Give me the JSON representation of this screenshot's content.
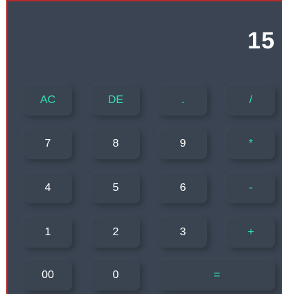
{
  "display": {
    "value": "15"
  },
  "keys": {
    "ac": "AC",
    "de": "DE",
    "dot": ".",
    "divide": "/",
    "seven": "7",
    "eight": "8",
    "nine": "9",
    "multiply": "*",
    "four": "4",
    "five": "5",
    "six": "6",
    "minus": "-",
    "one": "1",
    "two": "2",
    "three": "3",
    "plus": "+",
    "double_zero": "00",
    "zero": "0",
    "equals": "="
  },
  "colors": {
    "background": "#3b4452",
    "key": "#3a4350",
    "accent": "#2fe0b5",
    "text": "#ffffff",
    "border": "#b52a2a"
  }
}
